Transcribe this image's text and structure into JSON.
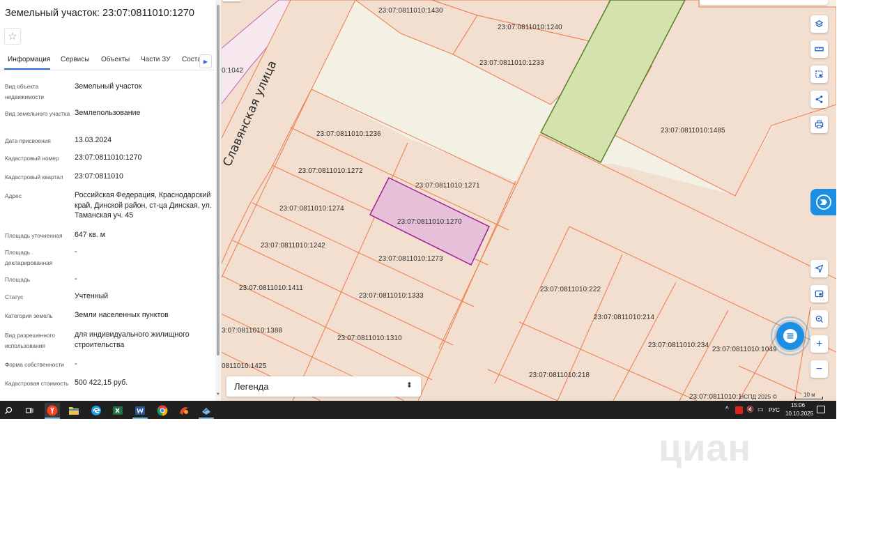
{
  "panel": {
    "title": "Земельный участок: 23:07:0811010:1270",
    "star_icon": "☆",
    "tabs": [
      {
        "label": "Информация"
      },
      {
        "label": "Сервисы"
      },
      {
        "label": "Объекты"
      },
      {
        "label": "Части ЗУ"
      },
      {
        "label": "Соста"
      }
    ],
    "rows": [
      {
        "label": "Вид объекта недвижимости",
        "value": "Земельный участок"
      },
      {
        "label": "Вид земельного участка",
        "value": "Землепользование"
      },
      {
        "label": "Дата присвоения",
        "value": "13.03.2024"
      },
      {
        "label": "Кадастровый номер",
        "value": "23:07:0811010:1270"
      },
      {
        "label": "Кадастровый квартал",
        "value": "23:07:0811010"
      },
      {
        "label": "Адрес",
        "value": "Российская Федерация, Краснодарский край, Динской район, ст-ца Динская, ул. Таманская уч. 45"
      },
      {
        "label": "Площадь уточненная",
        "value": "647 кв. м"
      },
      {
        "label": "Площадь декларированная",
        "value": "-"
      },
      {
        "label": "Площадь",
        "value": "-"
      },
      {
        "label": "Статус",
        "value": "Учтенный"
      },
      {
        "label": "Категория земель",
        "value": "Земли населенных пунктов"
      },
      {
        "label": "Вид разрешенного использования",
        "value": "для индивидуального жилищного строительства"
      },
      {
        "label": "Форма собственности",
        "value": "-"
      },
      {
        "label": "Кадастровая стоимость",
        "value": "500 422,15 руб."
      }
    ]
  },
  "map": {
    "street_name": "Славянская улица",
    "selected_parcel": "23:07:0811010:1270",
    "parcel_labels": [
      "23:07:0811010:1430",
      "23:07:0811010:1240",
      "23:07:0811010:1233",
      "23:07:0811010:1485",
      "0:1042",
      "23:07:0811010:1236",
      "23:07:0811010:1272",
      "23:07:0811010:1271",
      "23:07:0811010:1274",
      "23:07:0811010:1270",
      "23:07:0811010:1242",
      "23:07:0811010:1273",
      "23:07:0811010:1411",
      "23:07:0811010:1333",
      "23:07:0811010:222",
      "23:07:0811010:214",
      "3:07:0811010:1388",
      "23:07:0811010:1310",
      "23:07:0811010:234",
      "23:07:0811010:1049",
      "0811010:1425",
      "23:07:0811010:218",
      "23:07:0811010:1"
    ],
    "legend_label": "Легенда",
    "copyright": "НСПД 2025 ©",
    "scale_label": "10 м",
    "tool_icons": [
      "layers-icon",
      "ruler-icon",
      "select-area-icon",
      "share-icon",
      "print-icon",
      "locate-icon",
      "minimap-icon",
      "geosearch-icon"
    ],
    "zoom_in": "+",
    "zoom_out": "−",
    "colors": {
      "parcel_fill": "#f2dfd0",
      "parcel_border": "#ee7b4a",
      "selected_fill": "#e6bfd8",
      "selected_border": "#a0209a",
      "green_fill": "#d4e3ae",
      "green_border": "#5a7d2a",
      "road_fill": "#f2f1e4",
      "accent": "#1d8fe2"
    }
  },
  "taskbar": {
    "apps": [
      "search-icon",
      "task-view-icon",
      "yandex-browser-icon",
      "file-explorer-icon",
      "edge-icon",
      "excel-icon",
      "word-icon",
      "chrome-icon",
      "app-icon",
      "app-icon-2"
    ],
    "lang": "РУС",
    "time": "15:06",
    "date": "10.10.2025"
  },
  "watermark": "циан"
}
